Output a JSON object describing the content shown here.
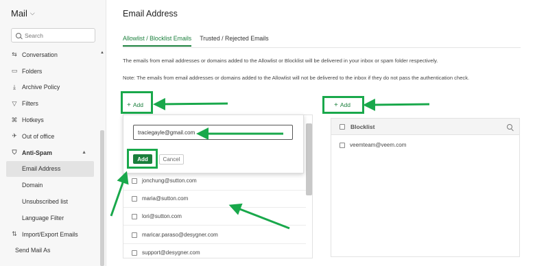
{
  "sidebar": {
    "app_title": "Mail",
    "search_placeholder": "Search",
    "items": [
      {
        "label": "Conversation",
        "icon": "conversation-icon",
        "glyph": "⇆"
      },
      {
        "label": "Folders",
        "icon": "folder-icon",
        "glyph": "▭"
      },
      {
        "label": "Archive Policy",
        "icon": "archive-icon",
        "glyph": "⤓"
      },
      {
        "label": "Filters",
        "icon": "filter-icon",
        "glyph": "▽"
      },
      {
        "label": "Hotkeys",
        "icon": "command-key-icon",
        "glyph": "⌘"
      },
      {
        "label": "Out of office",
        "icon": "plane-icon",
        "glyph": "✈"
      },
      {
        "label": "Anti-Spam",
        "icon": "shield-icon",
        "glyph": "⛉"
      },
      {
        "label": "Email Address"
      },
      {
        "label": "Domain"
      },
      {
        "label": "Unsubscribed list"
      },
      {
        "label": "Language Filter"
      },
      {
        "label": "Import/Export Emails",
        "icon": "import-export-icon",
        "glyph": "⇅"
      },
      {
        "label": "Send Mail As"
      }
    ]
  },
  "main": {
    "title": "Email Address",
    "tabs": [
      "Allowlist / Blocklist Emails",
      "Trusted / Rejected Emails"
    ],
    "desc1": "The emails from email addresses or domains added to the Allowlist or Blocklist will be delivered in your inbox or spam folder respectively.",
    "desc2": "Note: The emails from email addresses or domains added to the Allowlist will not be delivered to the inbox if they do not pass the authentication check.",
    "left_add_label": "Add",
    "right_add_label": "Add",
    "popup": {
      "input_value": "traciegayle@gmail.com",
      "add_label": "Add",
      "cancel_label": "Cancel"
    },
    "allowlist": [
      "jonchung@sutton.com",
      "maria@sutton.com",
      "lori@sutton.com",
      "maricar.paraso@desygner.com",
      "support@desygner.com"
    ],
    "blocklist_header": "Blocklist",
    "blocklist": [
      "veemteam@veem.com"
    ]
  },
  "colors": {
    "accent": "#1a7f3c",
    "annotation": "#19a84b"
  }
}
